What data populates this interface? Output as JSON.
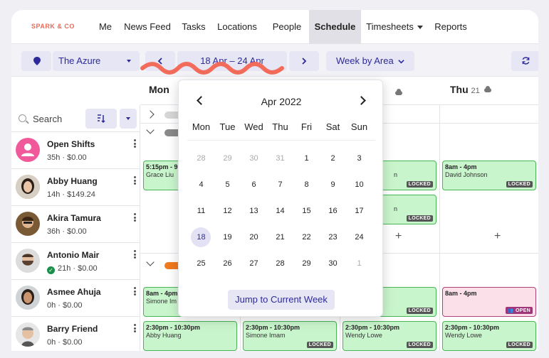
{
  "nav": {
    "logo": "SPARK & CO",
    "items": [
      {
        "label": "Me"
      },
      {
        "label": "News Feed"
      },
      {
        "label": "Tasks"
      },
      {
        "label": "Locations"
      },
      {
        "label": "People"
      },
      {
        "label": "Schedule",
        "active": true
      },
      {
        "label": "Timesheets",
        "dropdown": true
      },
      {
        "label": "Reports"
      }
    ]
  },
  "toolbar": {
    "location": "The Azure",
    "date_range": "18 Apr – 24 Apr",
    "view": "Week by Area",
    "icons": [
      "location-pin-icon",
      "chevron-left-icon",
      "chevron-right-icon",
      "refresh-icon"
    ]
  },
  "days": [
    {
      "name": "Mon",
      "num": ""
    },
    {
      "name": "Thu",
      "num": "21"
    }
  ],
  "search": {
    "placeholder": "Search"
  },
  "people": [
    {
      "name": "Open Shifts",
      "meta": "35h · $0.00"
    },
    {
      "name": "Abby Huang",
      "meta": "14h · $149.24"
    },
    {
      "name": "Akira Tamura",
      "meta": "36h · $0.00"
    },
    {
      "name": "Antonio Mair",
      "meta": "21h · $0.00",
      "verified": true
    },
    {
      "name": "Asmee Ahuja",
      "meta": "0h · $0.00"
    },
    {
      "name": "Barry Friend",
      "meta": "0h · $0.00"
    }
  ],
  "shifts": [
    {
      "time": "5:15pm - 9",
      "name": "Grace Liu",
      "tag": ""
    },
    {
      "time": "",
      "name": "n",
      "tag": "LOCKED"
    },
    {
      "time": "8am - 4pm",
      "name": "David Johnson",
      "tag": "LOCKED"
    },
    {
      "time": "",
      "name": "n",
      "tag": "LOCKED"
    },
    {
      "time": "8am - 4pm",
      "name": "Simone Im",
      "tag": ""
    },
    {
      "time": "",
      "name": "",
      "tag": "LOCKED"
    },
    {
      "time": "8am - 4pm",
      "name": "",
      "tag": "OPEN"
    },
    {
      "time": "2:30pm - 10:30pm",
      "name": "Abby Huang",
      "tag": ""
    },
    {
      "time": "2:30pm - 10:30pm",
      "name": "Simone Imam",
      "tag": "LOCKED"
    },
    {
      "time": "2:30pm - 10:30pm",
      "name": "Wendy Lowe",
      "tag": "LOCKED"
    },
    {
      "time": "2:30pm - 10:30pm",
      "name": "Wendy Lowe",
      "tag": "LOCKED"
    }
  ],
  "calendar": {
    "title": "Apr 2022",
    "weekdays": [
      "Mon",
      "Tue",
      "Wed",
      "Thu",
      "Fri",
      "Sat",
      "Sun"
    ],
    "weeks": [
      [
        "28",
        "29",
        "30",
        "31",
        "1",
        "2",
        "3"
      ],
      [
        "4",
        "5",
        "6",
        "7",
        "8",
        "9",
        "10"
      ],
      [
        "11",
        "12",
        "13",
        "14",
        "15",
        "16",
        "17"
      ],
      [
        "18",
        "19",
        "20",
        "21",
        "22",
        "23",
        "24"
      ],
      [
        "25",
        "26",
        "27",
        "28",
        "29",
        "30",
        "1"
      ]
    ],
    "selected": "18",
    "jump_label": "Jump to Current Week"
  },
  "colors": {
    "accent": "#2e2a9a",
    "shift_green": "#c9f5cc",
    "open_shift": "#fbe0ea",
    "squiggle": "#f26b5b"
  }
}
